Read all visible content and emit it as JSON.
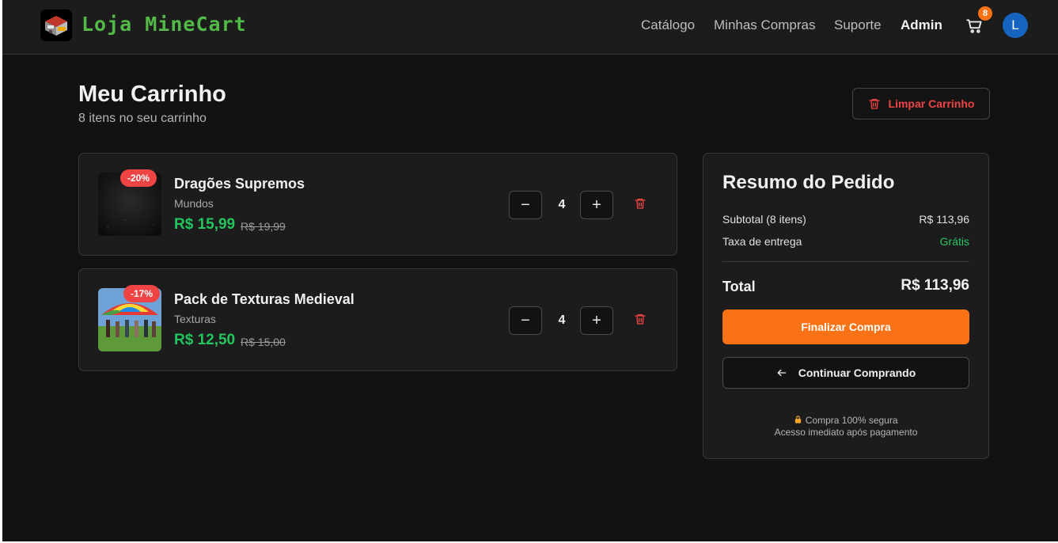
{
  "header": {
    "brand": "Loja MineCart",
    "nav": [
      "Catálogo",
      "Minhas Compras",
      "Suporte",
      "Admin"
    ],
    "cart_count": "8",
    "avatar_initial": "L"
  },
  "page": {
    "title": "Meu Carrinho",
    "subtitle": "8 itens no seu carrinho",
    "clear_label": "Limpar Carrinho"
  },
  "cart": {
    "items": [
      {
        "name": "Dragões Supremos",
        "category": "Mundos",
        "price": "R$ 15,99",
        "old_price": "R$ 19,99",
        "discount": "-20%",
        "quantity": "4",
        "thumb": "dark-texture"
      },
      {
        "name": "Pack de Texturas Medieval",
        "category": "Texturas",
        "price": "R$ 12,50",
        "old_price": "R$ 15,00",
        "discount": "-17%",
        "quantity": "4",
        "thumb": "parachute-photo"
      }
    ],
    "minus_glyph": "−",
    "plus_glyph": "+"
  },
  "summary": {
    "title": "Resumo do Pedido",
    "subtotal_label": "Subtotal (8 itens)",
    "subtotal_value": "R$ 113,96",
    "shipping_label": "Taxa de entrega",
    "shipping_value": "Grátis",
    "total_label": "Total",
    "total_value": "R$ 113,96",
    "checkout_label": "Finalizar Compra",
    "continue_label": "Continuar Comprando",
    "secure_line1": "Compra 100% segura",
    "secure_line2": "Acesso imediato após pagamento"
  },
  "colors": {
    "accent": "#f97316",
    "price_green": "#22c55e",
    "danger": "#ef4444",
    "brand_green": "#52b847",
    "avatar_blue": "#1565c0"
  },
  "icons": [
    "store-logo-icon",
    "cart-icon",
    "trash-icon",
    "arrow-left-icon",
    "lock-icon"
  ]
}
